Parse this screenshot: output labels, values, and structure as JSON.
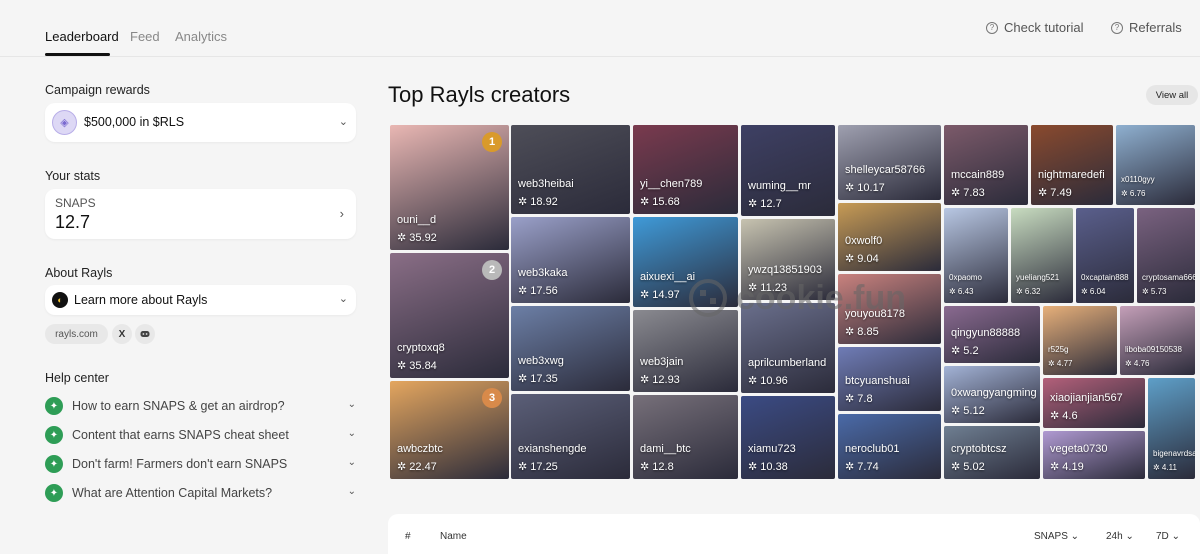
{
  "tabs": [
    "Leaderboard",
    "Feed",
    "Analytics"
  ],
  "header_links": {
    "tutorial": "Check tutorial",
    "referrals": "Referrals"
  },
  "sidebar": {
    "campaign_title": "Campaign rewards",
    "campaign_value": "$500,000 in $RLS",
    "stats_title": "Your stats",
    "snaps_label": "SNAPS",
    "snaps_value": "12.7",
    "about_title": "About Rayls",
    "about_link": "Learn more about Rayls",
    "site_link": "rayls.com",
    "x_icon": "X",
    "help_title": "Help center",
    "help_items": [
      "How to earn SNAPS & get an airdrop?",
      "Content that earns SNAPS cheat sheet",
      "Don't farm! Farmers don't earn SNAPS",
      "What are Attention Capital Markets?"
    ]
  },
  "main": {
    "title": "Top Rayls creators",
    "view_all": "View all",
    "watermark": "cookie.fun"
  },
  "creators": [
    {
      "name": "ouni__d",
      "score": "35.92",
      "rank": "1",
      "color": "#e9b7b3"
    },
    {
      "name": "cryptoxq8",
      "score": "35.84",
      "rank": "2",
      "color": "#8a6e86"
    },
    {
      "name": "awbczbtc",
      "score": "22.47",
      "rank": "3",
      "color": "#e4a65f"
    },
    {
      "name": "web3heibai",
      "score": "18.92",
      "color": "#4e4e58"
    },
    {
      "name": "web3kaka",
      "score": "17.56",
      "color": "#9aa0c9"
    },
    {
      "name": "web3xwg",
      "score": "17.35",
      "color": "#6c7fa6"
    },
    {
      "name": "exianshengde",
      "score": "17.25",
      "color": "#5b5f78"
    },
    {
      "name": "yi__chen789",
      "score": "15.68",
      "color": "#7a3a4e"
    },
    {
      "name": "aixuexi__ai",
      "score": "14.97",
      "color": "#3f9ad8"
    },
    {
      "name": "web3jain",
      "score": "12.93",
      "color": "#8a8a90"
    },
    {
      "name": "dami__btc",
      "score": "12.8",
      "color": "#77707a"
    },
    {
      "name": "wuming__mr",
      "score": "12.7",
      "color": "#3e4064"
    },
    {
      "name": "ywzq13851903",
      "score": "11.23",
      "color": "#c7c3b0"
    },
    {
      "name": "aprilcumberland",
      "score": "10.96",
      "color": "#6a6f8c"
    },
    {
      "name": "xiamu723",
      "score": "10.38",
      "color": "#3b4b84"
    },
    {
      "name": "shelleycar58766",
      "score": "10.17",
      "color": "#9fa0b0"
    },
    {
      "name": "0xwolf0",
      "score": "9.04",
      "color": "#c79b55"
    },
    {
      "name": "youyou8178",
      "score": "8.85",
      "color": "#c9827e"
    },
    {
      "name": "btcyuanshuai",
      "score": "7.8",
      "color": "#6f7cb6"
    },
    {
      "name": "neroclub01",
      "score": "7.74",
      "color": "#4a6aa8"
    },
    {
      "name": "mccain889",
      "score": "7.83",
      "color": "#7c5a6a"
    },
    {
      "name": "nightmaredefi",
      "score": "7.49",
      "color": "#8a4a2e"
    },
    {
      "name": "x0110gyy",
      "score": "6.76",
      "color": "#8fb0d0"
    },
    {
      "name": "0xpaomo",
      "score": "6.43",
      "color": "#b8c7e3"
    },
    {
      "name": "yueliang521",
      "score": "6.32",
      "color": "#c8dcc0"
    },
    {
      "name": "0xcaptain888",
      "score": "6.04",
      "color": "#5a5f8c"
    },
    {
      "name": "cryptosama666",
      "score": "5.73",
      "color": "#7a6280"
    },
    {
      "name": "qingyun88888",
      "score": "5.2",
      "color": "#8a6a90"
    },
    {
      "name": "0xwangyangming",
      "score": "5.12",
      "color": "#a3b3d6"
    },
    {
      "name": "cryptobtcsz",
      "score": "5.02",
      "color": "#6f7f92"
    },
    {
      "name": "r525g",
      "score": "4.77",
      "color": "#e7b07a"
    },
    {
      "name": "liboba09150538",
      "score": "4.76",
      "color": "#c49fb8"
    },
    {
      "name": "xiaojianjian567",
      "score": "4.6",
      "color": "#b3607a"
    },
    {
      "name": "vegeta0730",
      "score": "4.19",
      "color": "#b09ad2"
    },
    {
      "name": "bigenavrdsam",
      "score": "4.11",
      "color": "#5e9fc8"
    }
  ],
  "table": {
    "hash": "#",
    "name": "Name",
    "snaps": "SNAPS",
    "period_24h": "24h",
    "period_7d": "7D"
  },
  "colors": {
    "accent": "#111111",
    "help_icon": "#2e9d56",
    "gold": "#d99a2b",
    "silver": "#b9b9b9",
    "bronze": "#d88a4a"
  }
}
